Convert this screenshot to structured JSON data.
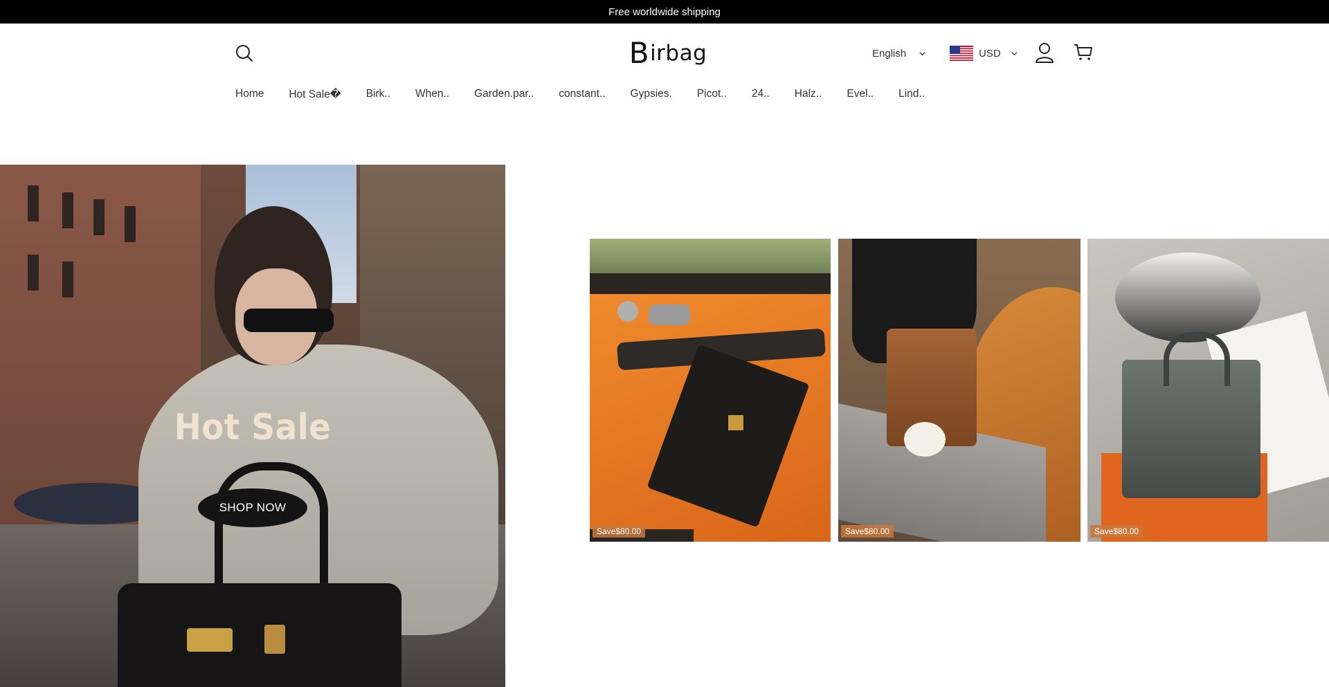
{
  "announcement": {
    "text": "Free worldwide shipping"
  },
  "header": {
    "logo": {
      "initial": "B",
      "rest": "irbag"
    },
    "language": "English",
    "currency": "USD",
    "icons": [
      "search-icon",
      "user-icon",
      "cart-icon",
      "us-flag-icon",
      "chevron-down-icon"
    ]
  },
  "nav": {
    "items": [
      {
        "label": "Home"
      },
      {
        "label": "Hot Sale�"
      },
      {
        "label": "Birk.."
      },
      {
        "label": "When.."
      },
      {
        "label": "Garden.par.."
      },
      {
        "label": "constant.."
      },
      {
        "label": "Gypsies."
      },
      {
        "label": "Picot.."
      },
      {
        "label": "24.."
      },
      {
        "label": "Halz.."
      },
      {
        "label": "Evel.."
      },
      {
        "label": "Lind.."
      }
    ]
  },
  "hero": {
    "title": "Hot Sale",
    "button": "SHOP NOW"
  },
  "products": [
    {
      "badge": "Save$80.00"
    },
    {
      "badge": "Save$80.00"
    },
    {
      "badge": "Save$80.00"
    }
  ],
  "colors": {
    "announcement_bg": "#000000",
    "hero_button_bg": "#141414",
    "hero_title": "#efe2cf"
  }
}
